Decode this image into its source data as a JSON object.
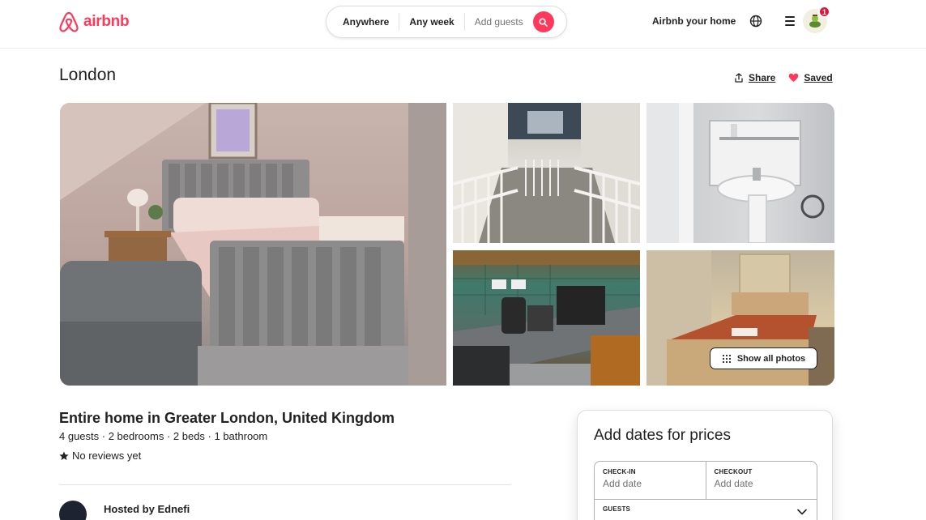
{
  "header": {
    "logo_text": "airbnb",
    "search": {
      "anywhere": "Anywhere",
      "any_week": "Any week",
      "add_guests": "Add guests"
    },
    "host_link": "Airbnb your home",
    "notification_count": "1"
  },
  "listing": {
    "title": "London",
    "share_label": "Share",
    "saved_label": "Saved",
    "show_all_photos": "Show all photos",
    "heading": "Entire home in Greater London, United Kingdom",
    "details": "4 guests · 2 bedrooms · 2 beds · 1 bathroom",
    "reviews": "No reviews yet",
    "hosted_by": "Hosted by Ednefi"
  },
  "booking": {
    "title": "Add dates for prices",
    "checkin_label": "CHECK-IN",
    "checkin_value": "Add date",
    "checkout_label": "CHECKOUT",
    "checkout_value": "Add date",
    "guests_label": "GUESTS"
  },
  "colors": {
    "brand": "#ff385c",
    "text": "#222222",
    "muted": "#717171"
  }
}
